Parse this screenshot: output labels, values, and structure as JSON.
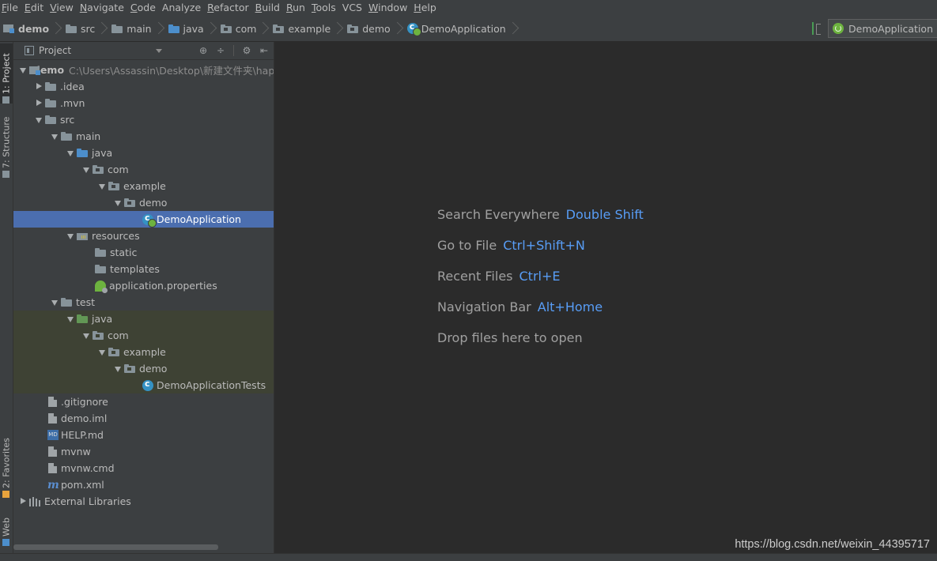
{
  "menubar": {
    "items": [
      {
        "mnemonic": "F",
        "rest": "ile"
      },
      {
        "mnemonic": "E",
        "rest": "dit"
      },
      {
        "mnemonic": "V",
        "rest": "iew"
      },
      {
        "mnemonic": "N",
        "rest": "avigate"
      },
      {
        "mnemonic": "C",
        "rest": "ode"
      },
      {
        "mnemonic": "",
        "rest": "Analyze"
      },
      {
        "mnemonic": "R",
        "rest": "efactor"
      },
      {
        "mnemonic": "B",
        "rest": "uild"
      },
      {
        "mnemonic": "R",
        "rest": "un"
      },
      {
        "mnemonic": "T",
        "rest": "ools"
      },
      {
        "mnemonic": "",
        "rest": "VCS"
      },
      {
        "mnemonic": "W",
        "rest": "indow"
      },
      {
        "mnemonic": "H",
        "rest": "elp"
      }
    ]
  },
  "breadcrumb": [
    "demo",
    "src",
    "main",
    "java",
    "com",
    "example",
    "demo",
    "DemoApplication"
  ],
  "run_config": {
    "label": "DemoApplication",
    "build_icon": "build-icon"
  },
  "left_strip": {
    "project_tab": "1: Project",
    "structure_tab": "7: Structure",
    "favorites_tab": "2: Favorites",
    "web_tab": "Web"
  },
  "project_panel": {
    "view_label": "Project",
    "tools": [
      "⊕",
      "÷",
      "⚙",
      "⇤"
    ]
  },
  "tree": {
    "root_name": "demo",
    "root_path": "C:\\Users\\Assassin\\Desktop\\新建文件夹\\hap",
    "idea": ".idea",
    "mvn": ".mvn",
    "src": "src",
    "main": "main",
    "java": "java",
    "com": "com",
    "example": "example",
    "demo": "demo",
    "demo_application": "DemoApplication",
    "resources": "resources",
    "static": "static",
    "templates": "templates",
    "application_properties": "application.properties",
    "test": "test",
    "test_java": "java",
    "test_com": "com",
    "test_example": "example",
    "test_demo": "demo",
    "demo_application_tests": "DemoApplicationTests",
    "gitignore": ".gitignore",
    "demo_iml": "demo.iml",
    "help_md": "HELP.md",
    "mvnw": "mvnw",
    "mvnw_cmd": "mvnw.cmd",
    "pom_xml": "pom.xml",
    "external_libraries": "External Libraries"
  },
  "editor": {
    "hints": [
      {
        "text": "Search Everywhere",
        "key": "Double Shift"
      },
      {
        "text": "Go to File",
        "key": "Ctrl+Shift+N"
      },
      {
        "text": "Recent Files",
        "key": "Ctrl+E"
      },
      {
        "text": "Navigation Bar",
        "key": "Alt+Home"
      },
      {
        "text": "Drop files here to open",
        "key": ""
      }
    ],
    "watermark": "https://blog.csdn.net/weixin_44395717"
  },
  "colors": {
    "background": "#3c3f41",
    "editor": "#2b2b2b",
    "selection": "#4b6eaf",
    "shortcut": "#589df6",
    "test_source": "#629755",
    "source_folder": "#4c8ecb"
  }
}
